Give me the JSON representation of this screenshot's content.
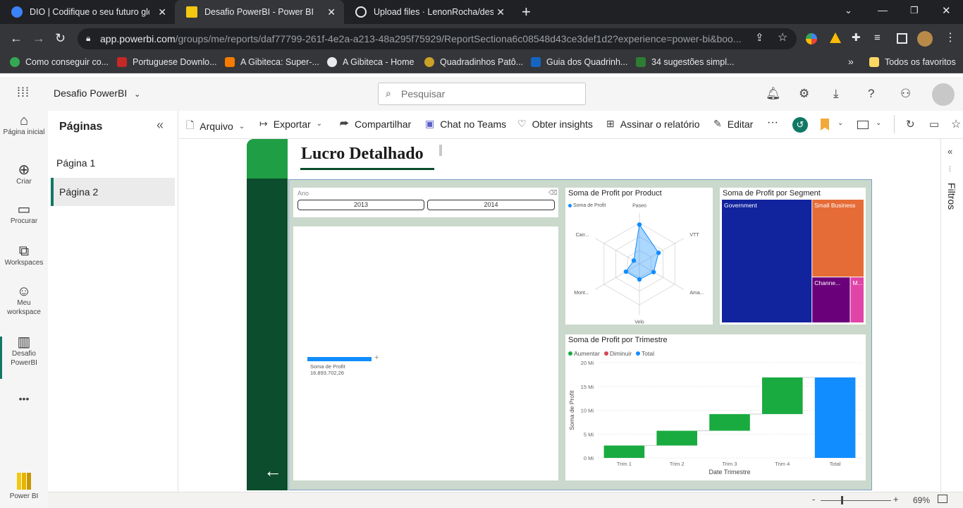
{
  "browser": {
    "tabs": [
      {
        "title": "DIO | Codifique o seu futuro glo",
        "color": "#3b82f6"
      },
      {
        "title": "Desafio PowerBI - Power BI",
        "color": "#f2c811"
      },
      {
        "title": "Upload files · LenonRocha/desafi",
        "color": "#e8eaed"
      }
    ],
    "new_tab": "+",
    "url_host": "app.powerbi.com",
    "url_path": "/groups/me/reports/daf77799-261f-4e2a-a213-48a295f75929/ReportSectiona6c08548d43ce3def1d2?experience=power-bi&boo...",
    "bookmarks": [
      {
        "label": "Como conseguir co...",
        "color": "#34a853"
      },
      {
        "label": "Portuguese Downlo...",
        "color": "#c62828"
      },
      {
        "label": "A Gibiteca: Super-...",
        "color": "#f57c00"
      },
      {
        "label": "A Gibiteca - Home",
        "color": "#e8eaed"
      },
      {
        "label": "Quadradinhos Patô...",
        "color": "#c9a227"
      },
      {
        "label": "Guia dos Quadrinh...",
        "color": "#1565c0"
      },
      {
        "label": "34 sugestões simpl...",
        "color": "#2e7d32"
      }
    ],
    "bookmarks_more": "»",
    "all_bookmarks": "Todos os favoritos"
  },
  "app": {
    "workspace_title": "Desafio PowerBI",
    "search_placeholder": "Pesquisar"
  },
  "leftnav": [
    {
      "label": "Página inicial",
      "icon": "home-icon"
    },
    {
      "label": "Criar",
      "icon": "plus-circle-icon"
    },
    {
      "label": "Procurar",
      "icon": "folder-icon"
    },
    {
      "label": "Workspaces",
      "icon": "workspaces-icon"
    },
    {
      "label": "Meu workspace",
      "icon": "person-icon"
    },
    {
      "label": "Desafio PowerBI",
      "icon": "report-icon"
    }
  ],
  "leftnav_more": "•••",
  "leftnav_bottom": "Power BI",
  "pages_pane": {
    "title": "Páginas",
    "collapse": "«",
    "pages": [
      "Página 1",
      "Página 2"
    ],
    "selected": 1
  },
  "actionbar": {
    "arquivo": "Arquivo",
    "exportar": "Exportar",
    "compartilhar": "Compartilhar",
    "chat": "Chat no Teams",
    "insights": "Obter insights",
    "assinar": "Assinar o relatório",
    "editar": "Editar",
    "more": "···"
  },
  "filters_label": "Filtros",
  "statusbar": {
    "minus": "-",
    "plus": "+",
    "zoom": "69%"
  },
  "report": {
    "title": "Lucro Detalhado",
    "slicer": {
      "title": "Ano",
      "options": [
        "2013",
        "2014"
      ]
    },
    "card": {
      "label": "Soma de Profit",
      "value": "16.893.702,26"
    },
    "colors": {
      "dark_green": "#0b4d2c",
      "green": "#1f9e45",
      "bg": "#cbd8cc",
      "accent_blue": "#118dff"
    }
  },
  "chart_data": [
    {
      "type": "radar",
      "title": "Soma de Profit por Product",
      "legend": [
        "Soma de Profit"
      ],
      "categories": [
        "Paseo",
        "VTT",
        "Ama...",
        "Velo",
        "Mont...",
        "Carr..."
      ],
      "values": [
        4.8,
        2.7,
        2.0,
        1.9,
        1.9,
        0.8
      ]
    },
    {
      "type": "treemap",
      "title": "Soma de Profit por Segment",
      "categories": [
        "Government",
        "Small Business",
        "Channe...",
        "M..."
      ],
      "values": [
        11.39,
        4.14,
        1.8,
        0.66
      ],
      "colors": [
        "#12239e",
        "#e66c37",
        "#6b007b",
        "#e044a7"
      ]
    },
    {
      "type": "waterfall",
      "title": "Soma de Profit por Trimestre",
      "legend": [
        {
          "label": "Aumentar",
          "color": "#1aab40"
        },
        {
          "label": "Diminuir",
          "color": "#d64550"
        },
        {
          "label": "Total",
          "color": "#118dff"
        }
      ],
      "categories": [
        "Trim 1",
        "Trim 2",
        "Trim 3",
        "Trim 4",
        "Total"
      ],
      "values": [
        2.6,
        3.1,
        3.5,
        7.7,
        16.9
      ],
      "xlabel": "Date Trimestre",
      "ylabel": "Soma de Profit",
      "yticks": [
        "0 Mi",
        "5 Mi",
        "10 Mi",
        "15 Mi",
        "20 Mi"
      ],
      "ylim": [
        0,
        20
      ]
    }
  ]
}
